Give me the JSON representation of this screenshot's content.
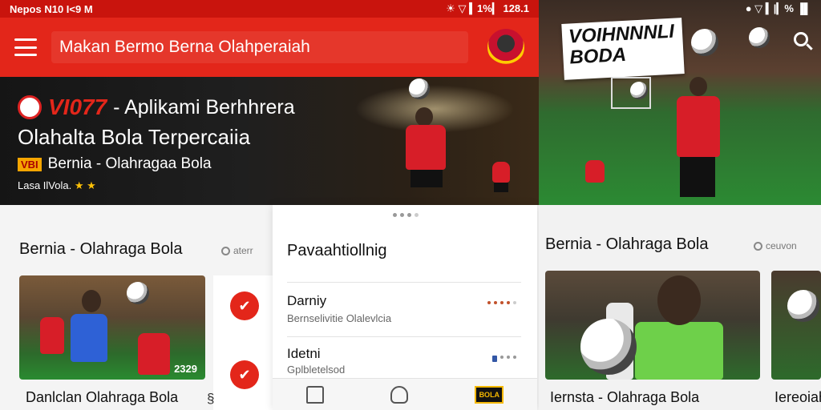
{
  "left": {
    "statusbar": {
      "left": "Nepos  N10 I<9  M",
      "right": "☀ ▽ ▍1%▎ 128.1"
    },
    "appbar": {
      "title": "Makan Bermo Berna Olahperaiah"
    },
    "hero": {
      "brand": "VI077",
      "title_line1": " - Aplikami Berhhrera",
      "title_line2": "Olahalta Bola Terpercaiia",
      "tag": "VBI",
      "subtitle": "Bernia - Olahragaa Bola",
      "rating_text": "Lasa IlVola.",
      "stars": "★ ★"
    },
    "section": {
      "title": "Bernia - Olahraga Bola",
      "search_hint": "aterr"
    },
    "card": {
      "caption": "Danlclan Olahraga Bola",
      "score": "2329"
    },
    "side_caption": "§"
  },
  "panel": {
    "title": "Pavaahtiollnig",
    "items": [
      {
        "title": "Darniy",
        "subtitle": "Bernselivitie Olalevlcia"
      },
      {
        "title": "Idetni",
        "subtitle": "Gplbletelsod"
      }
    ],
    "tab_logo": "BOLA"
  },
  "right": {
    "statusbar": {
      "right": "● ▽ ▍|▎% ▐▌"
    },
    "banner": "VOIHNNNLI BODA",
    "section": {
      "title": "Bernia - Olahraga Bola",
      "search_hint": "ceuvon"
    },
    "card": {
      "caption": "Iernsta - Olahraga Bola",
      "caption2": "Iereoiah"
    }
  }
}
